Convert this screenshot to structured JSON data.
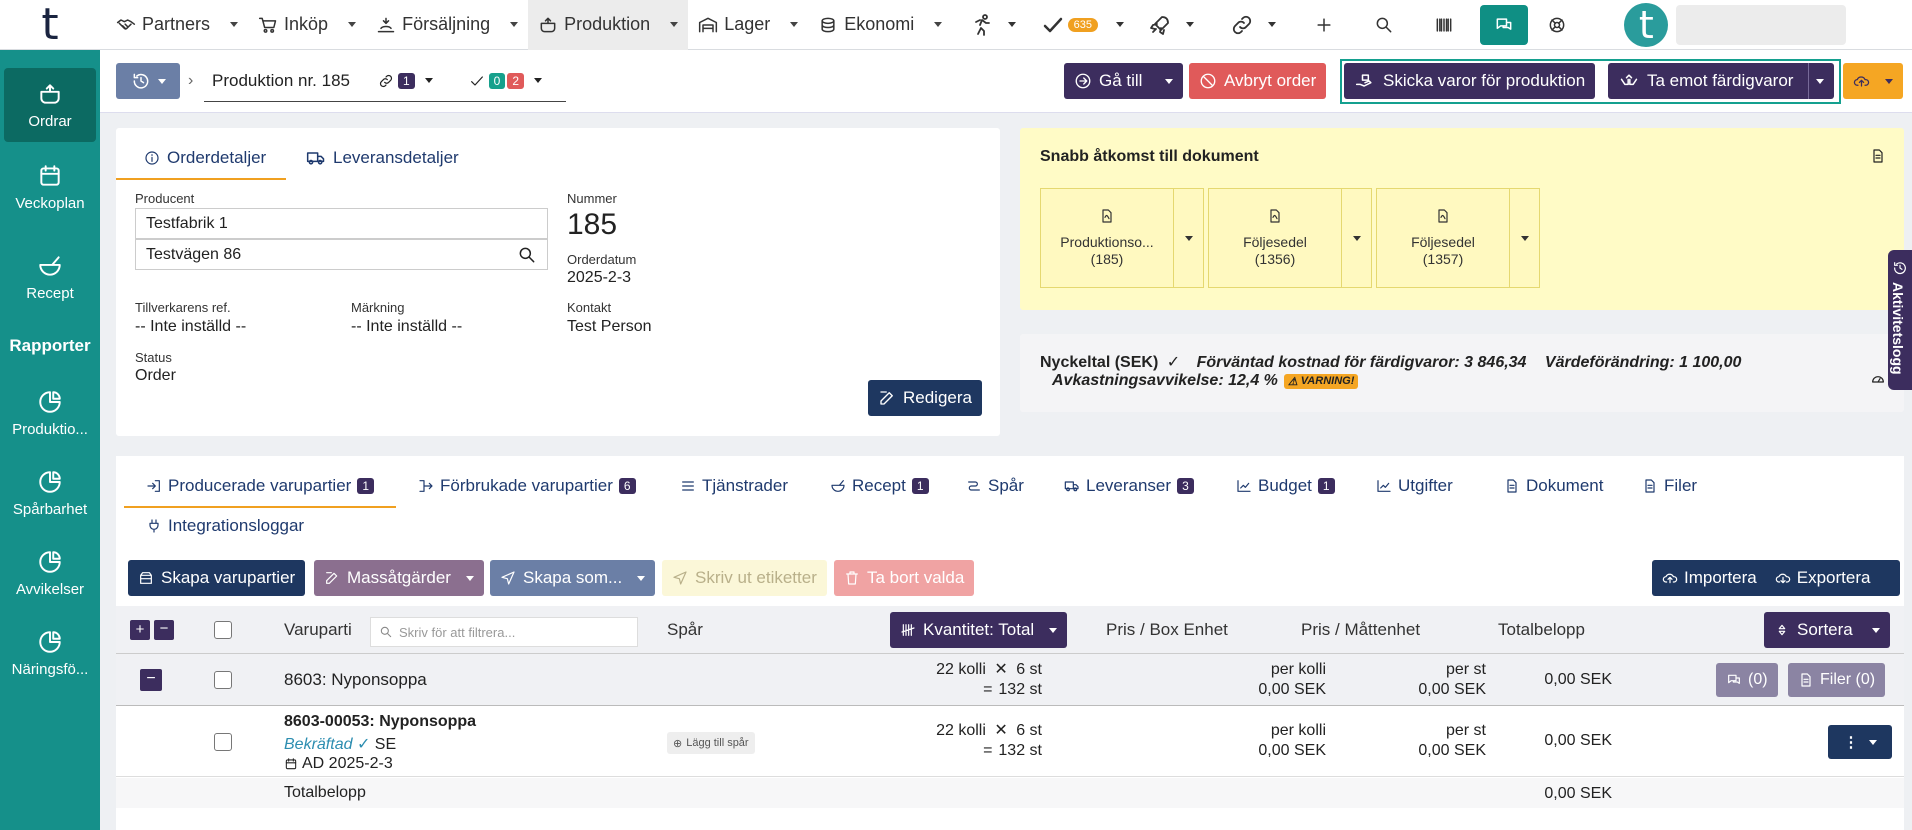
{
  "topnav": {
    "logo": "t",
    "items": [
      "Partners",
      "Inköp",
      "Försäljning",
      "Produktion",
      "Lager",
      "Ekonomi"
    ],
    "tasks_badge": "635",
    "avatar_letter": "t"
  },
  "sidebar": {
    "items": [
      "Ordrar",
      "Veckoplan",
      "Recept"
    ],
    "section": "Rapporter",
    "reports": [
      "Produktio...",
      "Spårbarhet",
      "Avvikelser",
      "Näringsfö..."
    ]
  },
  "subheader": {
    "order_title": "Produktion nr. 185",
    "links_count": "1",
    "checks_done": "0",
    "checks_open": "2",
    "goto": "Gå till",
    "cancel": "Avbryt order",
    "send": "Skicka varor för produktion",
    "receive": "Ta emot färdigvaror"
  },
  "order": {
    "tabs": [
      "Orderdetaljer",
      "Leveransdetaljer"
    ],
    "producer_label": "Producent",
    "producer_name": "Testfabrik 1",
    "producer_address": "Testvägen 86",
    "number_label": "Nummer",
    "number": "185",
    "date_label": "Orderdatum",
    "date": "2025-2-3",
    "maker_ref_label": "Tillverkarens ref.",
    "maker_ref": "-- Inte inställd --",
    "marking_label": "Märkning",
    "marking": "-- Inte inställd --",
    "contact_label": "Kontakt",
    "contact": "Test Person",
    "status_label": "Status",
    "status": "Order",
    "edit": "Redigera"
  },
  "quick_access": {
    "title": "Snabb åtkomst till dokument",
    "docs": [
      {
        "name": "Produktionso...",
        "num": "(185)"
      },
      {
        "name": "Följesedel",
        "num": "(1356)"
      },
      {
        "name": "Följesedel",
        "num": "(1357)"
      }
    ]
  },
  "kpi": {
    "title": "Nyckeltal (SEK)",
    "expected_cost": "Förväntad kostnad för färdigvaror: 3 846,34",
    "value_change": "Värdeförändring: 1 100,00",
    "yield_dev": "Avkastningsavvikelse: 12,4 %",
    "warning": "VARNING!"
  },
  "activity_log": "Aktivitetslogg",
  "tabs": [
    {
      "label": "Producerade varupartier",
      "count": "1"
    },
    {
      "label": "Förbrukade varupartier",
      "count": "6"
    },
    {
      "label": "Tjänstrader",
      "count": ""
    },
    {
      "label": "Recept",
      "count": "1"
    },
    {
      "label": "Spår",
      "count": ""
    },
    {
      "label": "Leveranser",
      "count": "3"
    },
    {
      "label": "Budget",
      "count": "1"
    },
    {
      "label": "Utgifter",
      "count": ""
    },
    {
      "label": "Dokument",
      "count": ""
    },
    {
      "label": "Filer",
      "count": ""
    },
    {
      "label": "Integrationsloggar",
      "count": ""
    }
  ],
  "actions": {
    "create": "Skapa varupartier",
    "mass": "Massåtgärder",
    "create_as": "Skapa som...",
    "print": "Skriv ut etiketter",
    "delete": "Ta bort valda",
    "import": "Importera",
    "export": "Exportera"
  },
  "table": {
    "col_batch": "Varuparti",
    "filter_placeholder": "Skriv för att filtrera...",
    "col_trace": "Spår",
    "quantity_btn": "Kvantitet: Total",
    "col_price_box": "Pris / Box Enhet",
    "col_price_unit": "Pris / Måttenhet",
    "col_total": "Totalbelopp",
    "sort": "Sortera",
    "group": {
      "name": "8603: Nyponsoppa",
      "qty1": "22 kolli",
      "qty2": "6 st",
      "qty3": "132 st",
      "pbox1": "per kolli",
      "pbox2": "0,00 SEK",
      "punit1": "per st",
      "punit2": "0,00 SEK",
      "total": "0,00 SEK",
      "comments": "(0)",
      "files": "Filer (0)"
    },
    "row": {
      "name": "8603-00053: Nyponsoppa",
      "state": "Bekräftad",
      "country": "SE",
      "date": "AD 2025-2-3",
      "add_trace": "Lägg till spår",
      "qty1": "22 kolli",
      "qty2": "6 st",
      "qty3": "132 st",
      "pbox1": "per kolli",
      "pbox2": "0,00 SEK",
      "punit1": "per st",
      "punit2": "0,00 SEK",
      "total": "0,00 SEK"
    },
    "total_label": "Totalbelopp",
    "total_value": "0,00 SEK"
  }
}
